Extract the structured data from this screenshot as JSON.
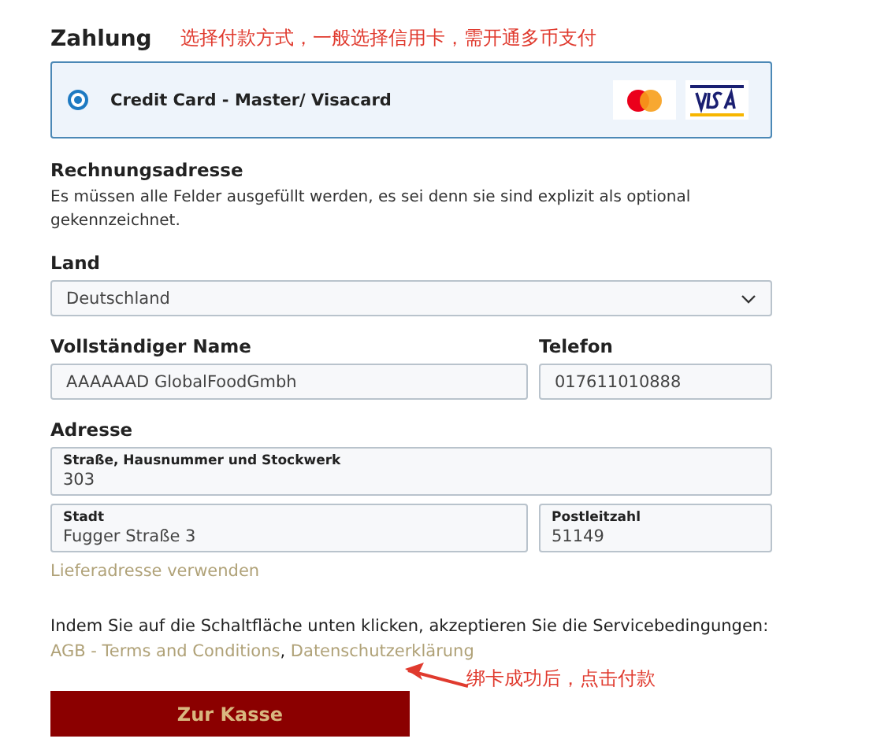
{
  "payment": {
    "heading": "Zahlung",
    "annotation": "选择付款方式，一般选择信用卡，需开通多币支付",
    "methods": [
      {
        "label": "Credit Card - Master/ Visacard",
        "selected": true
      }
    ]
  },
  "billing": {
    "heading": "Rechnungsadresse",
    "note": "Es müssen alle Felder ausgefüllt werden, es sei denn sie sind explizit als optional gekennzeichnet.",
    "country": {
      "label": "Land",
      "value": "Deutschland"
    },
    "name": {
      "label": "Vollständiger Name",
      "value": "AAAAAAD GlobalFoodGmbh"
    },
    "phone": {
      "label": "Telefon",
      "value": "017611010888"
    },
    "address_heading": "Adresse",
    "street": {
      "label": "Straße, Hausnummer und Stockwerk",
      "value": "303"
    },
    "city": {
      "label": "Stadt",
      "value": "Fugger Straße 3"
    },
    "postcode": {
      "label": "Postleitzahl",
      "value": "51149"
    }
  },
  "shipping_link": "Lieferadresse verwenden",
  "terms": [
    {
      "kind": "text",
      "text": "Indem Sie auf die Schaltfläche unten klicken, akzeptieren Sie die Servicebedingungen: "
    },
    {
      "kind": "link",
      "text": "AGB - Terms and Conditions"
    },
    {
      "kind": "text",
      "text": ", "
    },
    {
      "kind": "link",
      "text": "Datenschutzerklärung"
    }
  ],
  "checkout_button": "Zur Kasse",
  "button_annotation": "绑卡成功后，点击付款"
}
